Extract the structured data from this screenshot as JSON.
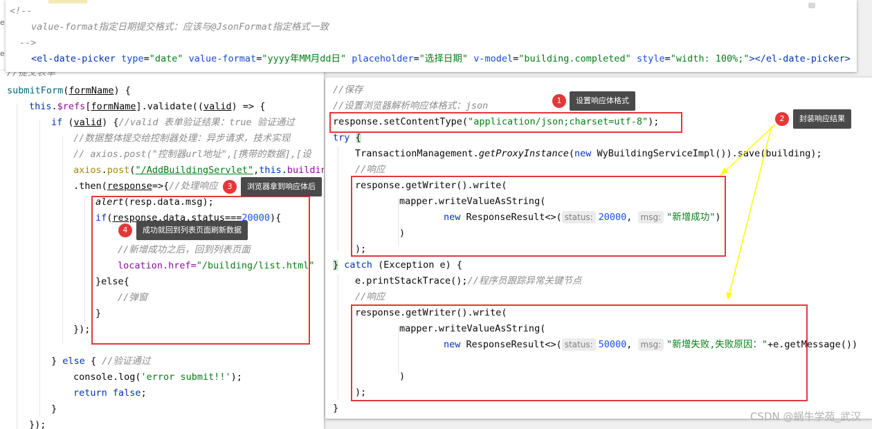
{
  "top_editor": {
    "line1": "<!--",
    "line2": "value-format指定日期提交格式：应该与@JsonFormat指定格式一致",
    "line3": "-->",
    "tag_open": "<el-date-picker",
    "attr_type": "type",
    "val_type": "\"date\"",
    "attr_value_format": "value-format",
    "val_value_format": "\"yyyy年MM月dd日\"",
    "attr_placeholder": "placeholder",
    "val_placeholder": "\"选择日期\"",
    "attr_vmodel": "v-model",
    "val_vmodel": "\"building.completed\"",
    "attr_style": "style",
    "val_style": "\"width: 100%;\"",
    "tag_close": "></el-date-picker>"
  },
  "left_editor": {
    "comment_submit": "//提交表单",
    "fn_name": "submitForm",
    "param": "formName",
    "this": "this",
    "refs": "$refs",
    "validate": "validate",
    "valid": "valid",
    "if_kw": "if",
    "comment_valid": "//valid 表单验证结果：true 验证通过",
    "comment_async": "//数据整体提交给控制器处理：异步请求，技术实现",
    "comment_axios": "// axios.post(\"控制器url地址\",[携带的数据],[设",
    "axios": "axios",
    "post": "post",
    "url": "\"/AddBuildingServlet\"",
    "building": "building",
    "then": "then",
    "response": "response",
    "comment_handle": "//处理响应",
    "alert": "alert",
    "alert_arg": "resp.data.msg",
    "status": "status",
    "status_num": "20000",
    "comment_after": "//新增成功之后，回到列表页面",
    "location": "location.href=",
    "location_url": "\"/building/list.html\"",
    "else": "}else{",
    "comment_popup": "//弹窗",
    "close_brace": "}",
    "close_then": "});",
    "else_kw": "else",
    "comment_validpass": "//验证通过",
    "console": "console.log(",
    "error_msg": "'error submit!!'",
    "return_kw": "return",
    "false_kw": "false",
    "semicolon": ";",
    "final_close": "});"
  },
  "right_editor": {
    "comment_save": "//保存",
    "comment_format": "//设置浏览器解析响应体格式：json",
    "set_content": "response.setContentType(",
    "content_type": "\"application/json;charset=utf-8\"",
    "set_end": ");",
    "try_kw": "try",
    "tx_call": "TransactionManagement.",
    "get_proxy": "getProxyInstance",
    "new_kw": "new",
    "impl": "WyBuildingServiceImpl()).save(building);",
    "comment_response": "//响应",
    "writer": "response.getWriter().write(",
    "mapper": "mapper.writeValueAsString(",
    "result_class": "ResponseResult<>(",
    "hint_status": "status:",
    "hint_msg": "msg:",
    "ok_status": "20000",
    "ok_msg": "\"新增成功\"",
    "fail_status": "50000",
    "fail_msg": "\"新增失败,失败原因：\"",
    "fail_tail": "+e.getMessage())",
    "catch_kw": "catch",
    "exception": "(Exception e) {",
    "print_trace": "e.printStackTrace();",
    "comment_trace": "//程序员跟踪异常关键节点",
    "close_paren": ")",
    "close_stmt": ");",
    "close_brace": "}",
    "close_paren_end": ")",
    "semicolon": ";",
    "try_close": "}"
  },
  "annotations": [
    {
      "num": "1",
      "text": "设置响应体格式"
    },
    {
      "num": "2",
      "text": "封装响应结果"
    },
    {
      "num": "3",
      "text": "浏览器拿到响应体后"
    },
    {
      "num": "4",
      "text": "成功就回到列表页面刷新数据"
    }
  ],
  "watermark": "CSDN @蜗牛学苑_武汉",
  "colors": {
    "annotation_red": "#e3373a",
    "tooltip_bg": "#4a4a4a",
    "arrow_yellow": "#ffff00",
    "keyword_blue": "#0033b3",
    "string_green": "#067d17"
  }
}
